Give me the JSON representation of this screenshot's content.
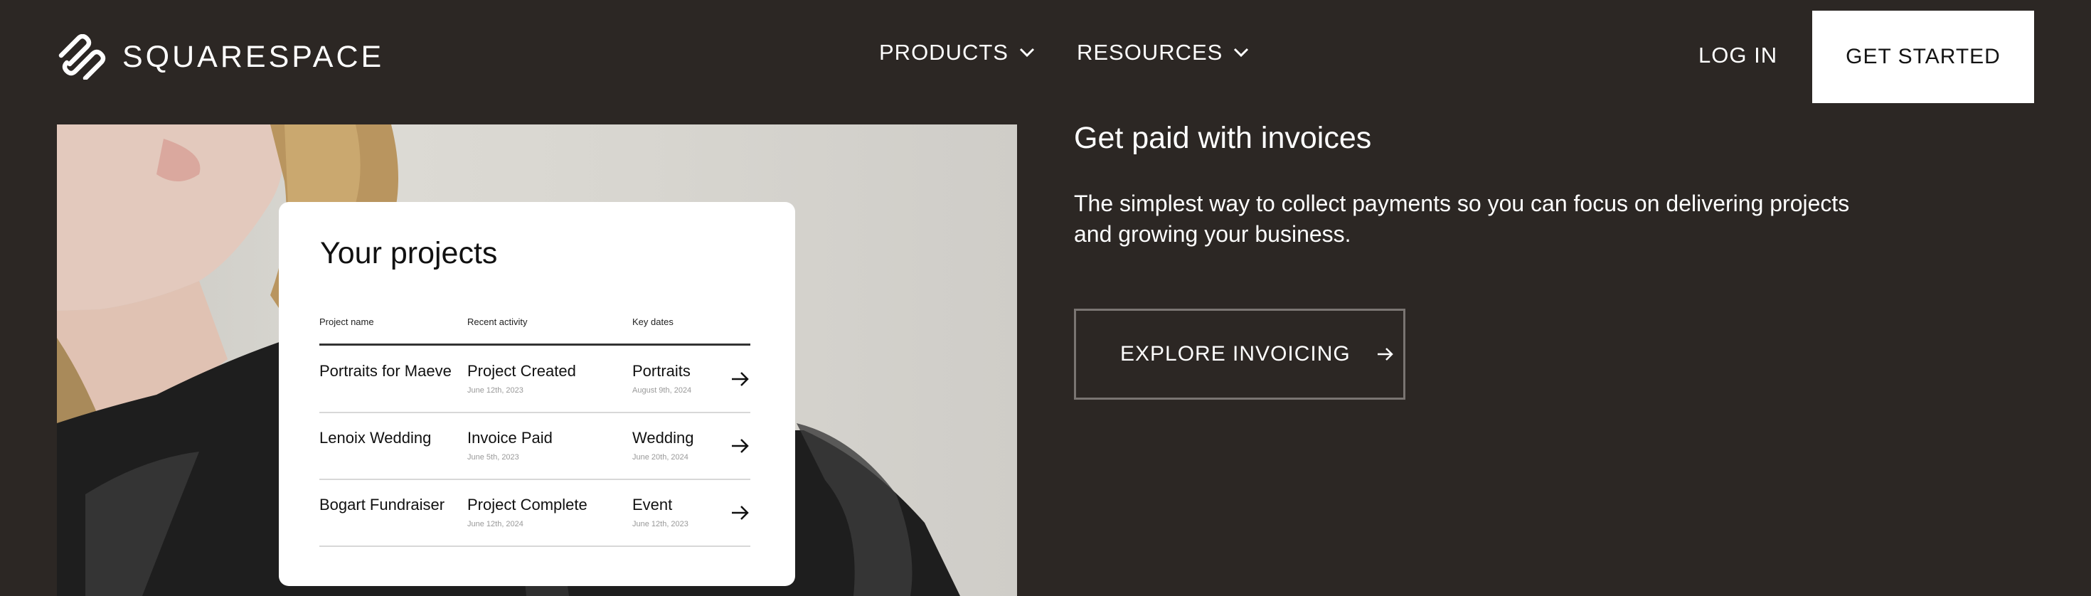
{
  "header": {
    "brand": "SQUARESPACE",
    "nav": [
      {
        "label": "PRODUCTS"
      },
      {
        "label": "RESOURCES"
      }
    ],
    "login_label": "LOG IN",
    "cta_label": "GET STARTED"
  },
  "card": {
    "title": "Your projects",
    "columns": [
      "Project name",
      "Recent activity",
      "Key dates"
    ],
    "rows": [
      {
        "name": "Portraits for Maeve",
        "activity": "Project Created",
        "activity_date": "June 12th, 2023",
        "key": "Portraits",
        "key_date": "August 9th, 2024"
      },
      {
        "name": "Lenoix Wedding",
        "activity": "Invoice Paid",
        "activity_date": "June 5th, 2023",
        "key": "Wedding",
        "key_date": "June 20th, 2024"
      },
      {
        "name": "Bogart Fundraiser",
        "activity": "Project Complete",
        "activity_date": "June 12th, 2024",
        "key": "Event",
        "key_date": "June 12th, 2023"
      }
    ]
  },
  "content": {
    "headline": "Get paid with invoices",
    "body": "The simplest way to collect payments so you can focus on delivering projects and growing your business.",
    "button_label": "EXPLORE INVOICING"
  },
  "colors": {
    "background": "#2c2724",
    "cta_bg": "#ffffff",
    "button_border": "#7a7572"
  },
  "icons": [
    "squarespace-logo-icon",
    "chevron-down-icon",
    "arrow-right-icon"
  ]
}
